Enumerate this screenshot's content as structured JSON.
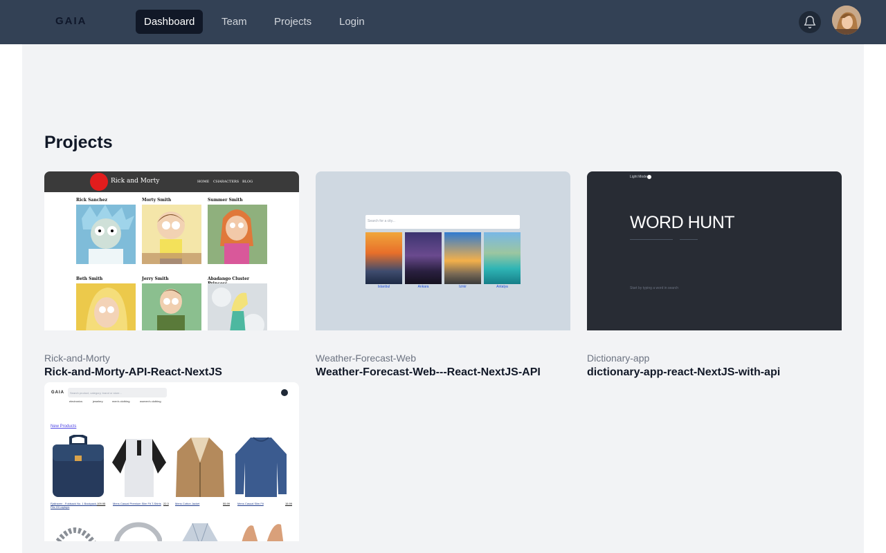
{
  "nav": {
    "logo": "GAIA",
    "links": [
      "Dashboard",
      "Team",
      "Projects",
      "Login"
    ]
  },
  "page": {
    "title": "Projects"
  },
  "projects": [
    {
      "category": "Rick-and-Morty",
      "name": "Rick-and-Morty-API-React-NextJS",
      "preview": {
        "title": "Rick and Morty",
        "menu": [
          "HOME",
          "CHARACTERS",
          "BLOG"
        ],
        "characters": [
          "Rick Sanchez",
          "Morty Smith",
          "Summer Smith",
          "Beth Smith",
          "Jerry Smith",
          "Abadango Cluster Princess"
        ]
      }
    },
    {
      "category": "Weather-Forecast-Web",
      "name": "Weather-Forecast-Web---React-NextJS-API",
      "preview": {
        "search_placeholder": "Search for a city...",
        "cities": [
          "Istanbul",
          "Ankara",
          "Izmir",
          "Antalya"
        ]
      }
    },
    {
      "category": "Dictionary-app",
      "name": "dictionary-app-react-NextJS-with-api",
      "preview": {
        "mode": "Light Mode",
        "title": "WORD HUNT",
        "hint": "Start by typing a word in search"
      }
    },
    {
      "category": "",
      "name": "",
      "preview": {
        "logo": "GAIA",
        "search_placeholder": "Search product, category, brand or store...",
        "categories": [
          "electronics",
          "jewelery",
          "men's clothing",
          "women's clothing"
        ],
        "section": "New Products",
        "products": [
          {
            "name": "Fjallraven - Foldsack No. 1 Backpack, Fits 15 Laptops",
            "price": "109.95"
          },
          {
            "name": "Mens Casual Premium Slim Fit T-Shirts",
            "price": "22.3"
          },
          {
            "name": "Mens Cotton Jacket",
            "price": "55.99"
          },
          {
            "name": "Mens Casual Slim Fit",
            "price": "15.99"
          }
        ]
      }
    }
  ],
  "colors": {
    "nav_bg": "#334155",
    "active_link_bg": "#111827",
    "content_bg": "#f2f3f5"
  }
}
